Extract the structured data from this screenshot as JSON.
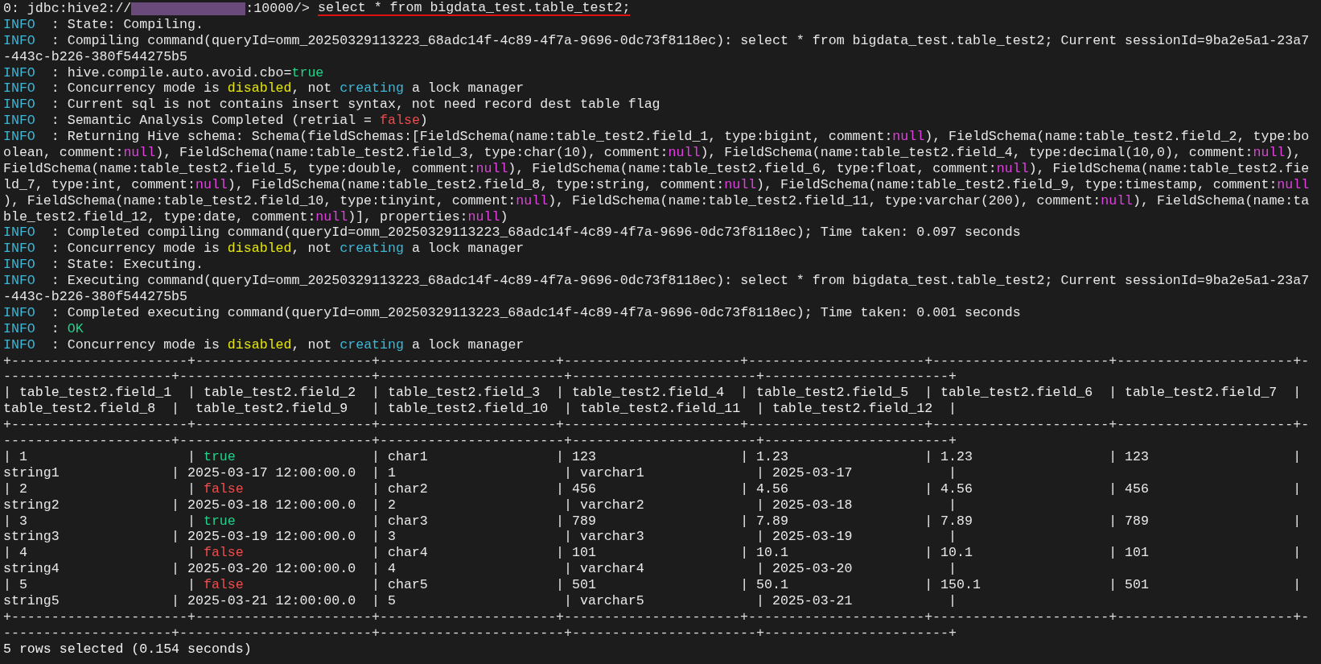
{
  "prompt": {
    "prefix": "0: jdbc:hive2://",
    "suffix": ":10000/>",
    "command": "select * from bigdata_test.table_test2;",
    "command_underlined": true
  },
  "lines": [
    {
      "kind": "log",
      "segments": [
        {
          "text": "INFO",
          "kind": "level"
        },
        {
          "text": "  : State: Compiling.",
          "kind": "plain"
        }
      ]
    },
    {
      "kind": "log",
      "segments": [
        {
          "text": "INFO",
          "kind": "level"
        },
        {
          "text": "  : Compiling command(queryId=omm_20250329113223_68adc14f-4c89-4f7a-9696-0dc73f8118ec): select * from bigdata_test.table_test2; Current sessionId=9ba2e5a1-23a7",
          "kind": "plain"
        }
      ]
    },
    {
      "kind": "log",
      "segments": [
        {
          "text": "-443c-b226-380f544275b5",
          "kind": "plain"
        }
      ]
    },
    {
      "kind": "log",
      "segments": [
        {
          "text": "INFO",
          "kind": "level"
        },
        {
          "text": "  : hive.compile.auto.avoid.cbo=",
          "kind": "plain"
        },
        {
          "text": "true",
          "kind": "bool_true"
        }
      ]
    },
    {
      "kind": "log",
      "segments": [
        {
          "text": "INFO",
          "kind": "level"
        },
        {
          "text": "  : Concurrency mode is ",
          "kind": "plain"
        },
        {
          "text": "disabled",
          "kind": "warn"
        },
        {
          "text": ", not ",
          "kind": "plain"
        },
        {
          "text": "creating",
          "kind": "action"
        },
        {
          "text": " a lock manager",
          "kind": "plain"
        }
      ]
    },
    {
      "kind": "log",
      "segments": [
        {
          "text": "INFO",
          "kind": "level"
        },
        {
          "text": "  : Current sql is not contains insert syntax, not need record dest table flag",
          "kind": "plain"
        }
      ]
    },
    {
      "kind": "log",
      "segments": [
        {
          "text": "INFO",
          "kind": "level"
        },
        {
          "text": "  : Semantic Analysis Completed (retrial = ",
          "kind": "plain"
        },
        {
          "text": "false",
          "kind": "bool_false"
        },
        {
          "text": ")",
          "kind": "plain"
        }
      ]
    },
    {
      "kind": "log",
      "segments": [
        {
          "text": "INFO",
          "kind": "level"
        },
        {
          "text": "  : Returning Hive schema: Schema(fieldSchemas:[FieldSchema(name:table_test2.field_1, type:bigint, comment:",
          "kind": "plain"
        },
        {
          "text": "null",
          "kind": "null"
        },
        {
          "text": "), FieldSchema(name:table_test2.field_2, type:bo",
          "kind": "plain"
        }
      ]
    },
    {
      "kind": "log",
      "segments": [
        {
          "text": "olean, comment:",
          "kind": "plain"
        },
        {
          "text": "null",
          "kind": "null"
        },
        {
          "text": "), FieldSchema(name:table_test2.field_3, type:char(10), comment:",
          "kind": "plain"
        },
        {
          "text": "null",
          "kind": "null"
        },
        {
          "text": "), FieldSchema(name:table_test2.field_4, type:decimal(10,0), comment:",
          "kind": "plain"
        },
        {
          "text": "null",
          "kind": "null"
        },
        {
          "text": "),",
          "kind": "plain"
        }
      ]
    },
    {
      "kind": "log",
      "segments": [
        {
          "text": "FieldSchema(name:table_test2.field_5, type:double, comment:",
          "kind": "plain"
        },
        {
          "text": "null",
          "kind": "null"
        },
        {
          "text": "), FieldSchema(name:table_test2.field_6, type:float, comment:",
          "kind": "plain"
        },
        {
          "text": "null",
          "kind": "null"
        },
        {
          "text": "), FieldSchema(name:table_test2.fie",
          "kind": "plain"
        }
      ]
    },
    {
      "kind": "log",
      "segments": [
        {
          "text": "ld_7, type:int, comment:",
          "kind": "plain"
        },
        {
          "text": "null",
          "kind": "null"
        },
        {
          "text": "), FieldSchema(name:table_test2.field_8, type:string, comment:",
          "kind": "plain"
        },
        {
          "text": "null",
          "kind": "null"
        },
        {
          "text": "), FieldSchema(name:table_test2.field_9, type:timestamp, comment:",
          "kind": "plain"
        },
        {
          "text": "null",
          "kind": "null"
        }
      ]
    },
    {
      "kind": "log",
      "segments": [
        {
          "text": "), FieldSchema(name:table_test2.field_10, type:tinyint, comment:",
          "kind": "plain"
        },
        {
          "text": "null",
          "kind": "null"
        },
        {
          "text": "), FieldSchema(name:table_test2.field_11, type:varchar(200), comment:",
          "kind": "plain"
        },
        {
          "text": "null",
          "kind": "null"
        },
        {
          "text": "), FieldSchema(name:ta",
          "kind": "plain"
        }
      ]
    },
    {
      "kind": "log",
      "segments": [
        {
          "text": "ble_test2.field_12, type:date, comment:",
          "kind": "plain"
        },
        {
          "text": "null",
          "kind": "null"
        },
        {
          "text": ")], properties:",
          "kind": "plain"
        },
        {
          "text": "null",
          "kind": "null"
        },
        {
          "text": ")",
          "kind": "plain"
        }
      ]
    },
    {
      "kind": "log",
      "segments": [
        {
          "text": "INFO",
          "kind": "level"
        },
        {
          "text": "  : Completed compiling command(queryId=omm_20250329113223_68adc14f-4c89-4f7a-9696-0dc73f8118ec); Time taken: 0.097 seconds",
          "kind": "plain"
        }
      ]
    },
    {
      "kind": "log",
      "segments": [
        {
          "text": "INFO",
          "kind": "level"
        },
        {
          "text": "  : Concurrency mode is ",
          "kind": "plain"
        },
        {
          "text": "disabled",
          "kind": "warn"
        },
        {
          "text": ", not ",
          "kind": "plain"
        },
        {
          "text": "creating",
          "kind": "action"
        },
        {
          "text": " a lock manager",
          "kind": "plain"
        }
      ]
    },
    {
      "kind": "log",
      "segments": [
        {
          "text": "INFO",
          "kind": "level"
        },
        {
          "text": "  : State: Executing.",
          "kind": "plain"
        }
      ]
    },
    {
      "kind": "log",
      "segments": [
        {
          "text": "INFO",
          "kind": "level"
        },
        {
          "text": "  : Executing command(queryId=omm_20250329113223_68adc14f-4c89-4f7a-9696-0dc73f8118ec): select * from bigdata_test.table_test2; Current sessionId=9ba2e5a1-23a7",
          "kind": "plain"
        }
      ]
    },
    {
      "kind": "log",
      "segments": [
        {
          "text": "-443c-b226-380f544275b5",
          "kind": "plain"
        }
      ]
    },
    {
      "kind": "log",
      "segments": [
        {
          "text": "INFO",
          "kind": "level"
        },
        {
          "text": "  : Completed executing command(queryId=omm_20250329113223_68adc14f-4c89-4f7a-9696-0dc73f8118ec); Time taken: 0.001 seconds",
          "kind": "plain"
        }
      ]
    },
    {
      "kind": "log",
      "segments": [
        {
          "text": "INFO",
          "kind": "level"
        },
        {
          "text": "  : ",
          "kind": "plain"
        },
        {
          "text": "OK",
          "kind": "ok"
        }
      ]
    },
    {
      "kind": "log",
      "segments": [
        {
          "text": "INFO",
          "kind": "level"
        },
        {
          "text": "  : Concurrency mode is ",
          "kind": "plain"
        },
        {
          "text": "disabled",
          "kind": "warn"
        },
        {
          "text": ", not ",
          "kind": "plain"
        },
        {
          "text": "creating",
          "kind": "action"
        },
        {
          "text": " a lock manager",
          "kind": "plain"
        }
      ]
    },
    {
      "kind": "border",
      "segments": [
        {
          "text": "+----------------------+----------------------+----------------------+----------------------+----------------------+----------------------+----------------------+-",
          "kind": "plain"
        }
      ]
    },
    {
      "kind": "border",
      "segments": [
        {
          "text": "---------------------+------------------------+-----------------------+-----------------------+-----------------------+",
          "kind": "plain"
        }
      ]
    },
    {
      "kind": "header",
      "segments": [
        {
          "text": "| table_test2.field_1  | table_test2.field_2  | table_test2.field_3  | table_test2.field_4  | table_test2.field_5  | table_test2.field_6  | table_test2.field_7  | ",
          "kind": "plain"
        }
      ]
    },
    {
      "kind": "header",
      "segments": [
        {
          "text": "table_test2.field_8  |  table_test2.field_9   | table_test2.field_10  | table_test2.field_11  | table_test2.field_12  |",
          "kind": "plain"
        }
      ]
    },
    {
      "kind": "border",
      "segments": [
        {
          "text": "+----------------------+----------------------+----------------------+----------------------+----------------------+----------------------+----------------------+-",
          "kind": "plain"
        }
      ]
    },
    {
      "kind": "border",
      "segments": [
        {
          "text": "---------------------+------------------------+-----------------------+-----------------------+-----------------------+",
          "kind": "plain"
        }
      ]
    },
    {
      "kind": "row",
      "segments": [
        {
          "text": "| 1                    | ",
          "kind": "plain"
        },
        {
          "text": "true",
          "kind": "bool_true"
        },
        {
          "text": "                 | char1                | 123                  | 1.23                 | 1.23                 | 123                  | ",
          "kind": "plain"
        }
      ]
    },
    {
      "kind": "row",
      "segments": [
        {
          "text": "string1              | 2025-03-17 12:00:00.0  | 1                     | varchar1              | 2025-03-17            |",
          "kind": "plain"
        }
      ]
    },
    {
      "kind": "row",
      "segments": [
        {
          "text": "| 2                    | ",
          "kind": "plain"
        },
        {
          "text": "false",
          "kind": "bool_false"
        },
        {
          "text": "                | char2                | 456                  | 4.56                 | 4.56                 | 456                  | ",
          "kind": "plain"
        }
      ]
    },
    {
      "kind": "row",
      "segments": [
        {
          "text": "string2              | 2025-03-18 12:00:00.0  | 2                     | varchar2              | 2025-03-18            |",
          "kind": "plain"
        }
      ]
    },
    {
      "kind": "row",
      "segments": [
        {
          "text": "| 3                    | ",
          "kind": "plain"
        },
        {
          "text": "true",
          "kind": "bool_true"
        },
        {
          "text": "                 | char3                | 789                  | 7.89                 | 7.89                 | 789                  | ",
          "kind": "plain"
        }
      ]
    },
    {
      "kind": "row",
      "segments": [
        {
          "text": "string3              | 2025-03-19 12:00:00.0  | 3                     | varchar3              | 2025-03-19            |",
          "kind": "plain"
        }
      ]
    },
    {
      "kind": "row",
      "segments": [
        {
          "text": "| 4                    | ",
          "kind": "plain"
        },
        {
          "text": "false",
          "kind": "bool_false"
        },
        {
          "text": "                | char4                | 101                  | 10.1                 | 10.1                 | 101                  | ",
          "kind": "plain"
        }
      ]
    },
    {
      "kind": "row",
      "segments": [
        {
          "text": "string4              | 2025-03-20 12:00:00.0  | 4                     | varchar4              | 2025-03-20            |",
          "kind": "plain"
        }
      ]
    },
    {
      "kind": "row",
      "segments": [
        {
          "text": "| 5                    | ",
          "kind": "plain"
        },
        {
          "text": "false",
          "kind": "bool_false"
        },
        {
          "text": "                | char5                | 501                  | 50.1                 | 150.1                | 501                  | ",
          "kind": "plain"
        }
      ]
    },
    {
      "kind": "row",
      "segments": [
        {
          "text": "string5              | 2025-03-21 12:00:00.0  | 5                     | varchar5              | 2025-03-21            |",
          "kind": "plain"
        }
      ]
    },
    {
      "kind": "border",
      "segments": [
        {
          "text": "+----------------------+----------------------+----------------------+----------------------+----------------------+----------------------+----------------------+-",
          "kind": "plain"
        }
      ]
    },
    {
      "kind": "border",
      "segments": [
        {
          "text": "---------------------+------------------------+-----------------------+-----------------------+-----------------------+",
          "kind": "plain"
        }
      ]
    },
    {
      "kind": "summary",
      "segments": [
        {
          "text": "5 rows selected (0.154 seconds)",
          "kind": "plain"
        }
      ]
    }
  ]
}
